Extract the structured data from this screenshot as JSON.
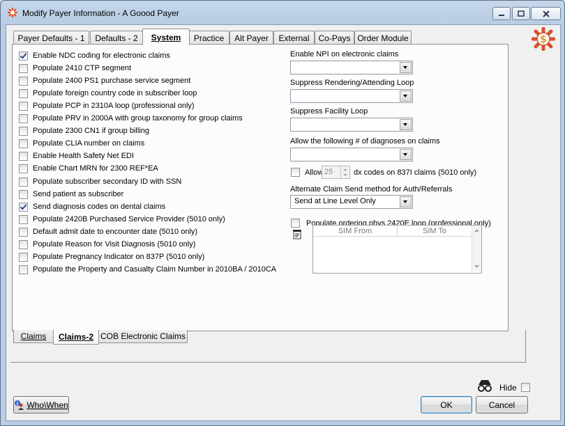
{
  "window": {
    "title": "Modify Payer Information - A Goood Payer"
  },
  "top_tabs": [
    {
      "label": "Payer Defaults - 1",
      "active": false
    },
    {
      "label": "Defaults - 2",
      "active": false
    },
    {
      "label": "System",
      "active": true
    },
    {
      "label": "Practice",
      "active": false
    },
    {
      "label": "Alt Payer",
      "active": false
    },
    {
      "label": "External",
      "active": false
    },
    {
      "label": "Co-Pays",
      "active": false
    },
    {
      "label": "Order Module",
      "active": false
    }
  ],
  "checkboxes": [
    {
      "label": "Enable NDC coding for electronic claims",
      "checked": true
    },
    {
      "label": "Populate 2410 CTP segment",
      "checked": false
    },
    {
      "label": "Populate 2400 PS1 purchase service segment",
      "checked": false
    },
    {
      "label": "Populate foreign country code in subscriber loop",
      "checked": false
    },
    {
      "label": "Populate PCP in 2310A loop (professional only)",
      "checked": false
    },
    {
      "label": "Populate PRV in 2000A with group taxonomy for group claims",
      "checked": false
    },
    {
      "label": "Populate 2300 CN1 if group billing",
      "checked": false
    },
    {
      "label": "Populate CLIA number on claims",
      "checked": false
    },
    {
      "label": "Enable Health Safety Net EDI",
      "checked": false
    },
    {
      "label": "Enable Chart MRN for 2300 REF*EA",
      "checked": false
    },
    {
      "label": "Populate subscriber secondary ID with SSN",
      "checked": false
    },
    {
      "label": "Send patient as subscriber",
      "checked": false
    },
    {
      "label": "Send diagnosis codes on dental claims",
      "checked": true
    },
    {
      "label": "Populate 2420B Purchased Service Provider (5010 only)",
      "checked": false
    },
    {
      "label": "Default admit date to encounter date (5010 only)",
      "checked": false
    },
    {
      "label": "Populate Reason for Visit Diagnosis (5010 only)",
      "checked": false
    },
    {
      "label": "Populate Pregnancy Indicator on 837P (5010 only)",
      "checked": false
    },
    {
      "label": "Populate the Property and Casualty Claim Number in  2010BA / 2010CA",
      "checked": false
    }
  ],
  "right": {
    "npi_label": "Enable NPI on electronic claims",
    "npi_value": "",
    "suppress_rendering_label": "Suppress Rendering/Attending Loop",
    "suppress_rendering_value": "",
    "suppress_facility_label": "Suppress Facility Loop",
    "suppress_facility_value": "",
    "diagnoses_label": "Allow the following # of diagnoses on claims",
    "diagnoses_value": "",
    "allow_label": "Allow",
    "allow_count": "25",
    "allow_suffix": "dx codes on 837I claims (5010 only)",
    "alt_send_label": "Alternate Claim Send method for Auth/Referrals",
    "alt_send_value": "Send at Line Level Only",
    "ordering_label": "Populate ordering phys 2420E loop (professional only)",
    "grid_headers": [
      "SIM From",
      "SIM To"
    ]
  },
  "bottom_tabs": [
    {
      "label": "Claims",
      "active": false
    },
    {
      "label": "Claims-2",
      "active": true
    },
    {
      "label": "COB Electronic Claims",
      "active": false
    }
  ],
  "footer": {
    "whowhen_label": "Who\\When",
    "hide_label": "Hide",
    "ok_label": "OK",
    "cancel_label": "Cancel"
  },
  "colors": {
    "check_mark": "#2a4a8f",
    "title_bar": "#b9cde4",
    "panel_bg": "#fcfcfc"
  }
}
